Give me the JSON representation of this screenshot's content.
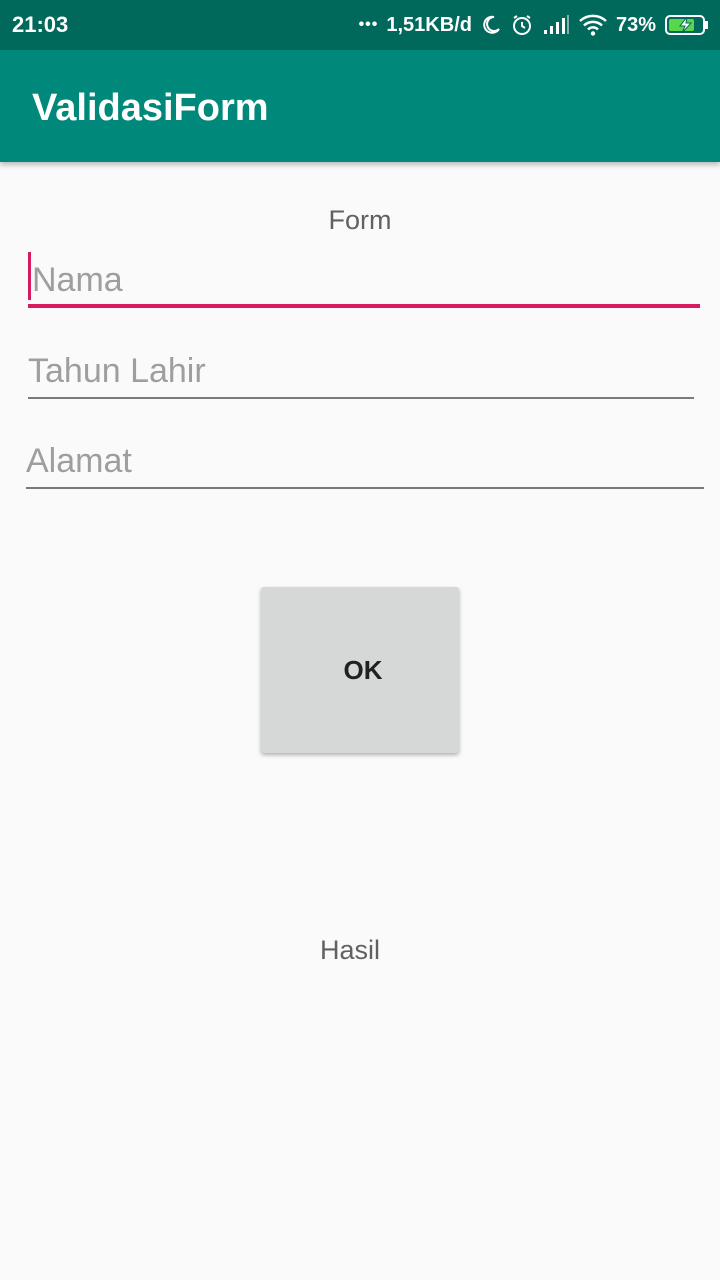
{
  "status_bar": {
    "time": "21:03",
    "more_indicator": "•••",
    "network_speed": "1,51KB/d",
    "battery_percent": "73%",
    "icons": [
      "moon-icon",
      "alarm-icon",
      "signal-icon",
      "wifi-icon",
      "battery-charging-icon"
    ]
  },
  "app_bar": {
    "title": "ValidasiForm",
    "color": "#00897b",
    "status_color": "#00695c"
  },
  "form": {
    "label": "Form",
    "fields": [
      {
        "placeholder": "Nama",
        "value": "",
        "focused": true
      },
      {
        "placeholder": "Tahun Lahir",
        "value": "",
        "focused": false
      },
      {
        "placeholder": "Alamat",
        "value": "",
        "focused": false
      }
    ],
    "accent_color": "#d81b60"
  },
  "ok_button": {
    "label": "OK"
  },
  "result": {
    "label": "Hasil"
  }
}
